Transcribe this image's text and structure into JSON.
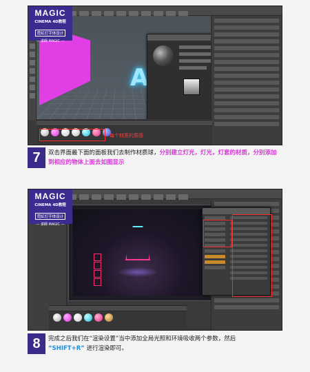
{
  "brand": {
    "magic": "MAGIC",
    "c4d": "CINEMA 4D教程",
    "sub": "霓虹灯字体设计",
    "tag": "— 讲師 MAGIC —"
  },
  "step7": {
    "number": "7",
    "annotation": "每个材质的质感",
    "text_normal_1": "双击界面最下面的面板我们去制作材质球，",
    "text_highlight": "分别建立灯光，灯光，灯套的材质，分别添加到相应的物体上面去如图显示",
    "viewport_letter": "A"
  },
  "step8": {
    "number": "8",
    "text_normal_1": "完成之后我们在“渲染设置”当中添加全局光照和环境吸收两个参数，然后",
    "text_highlight": "“SHIFT+R”",
    "text_normal_2": "进行渲染即可。"
  },
  "colors": {
    "brand_purple": "#3b2d8f",
    "magenta": "#e23ee6",
    "neon_cyan": "#9fe8ff",
    "annotation_red": "#ff2a2a"
  }
}
